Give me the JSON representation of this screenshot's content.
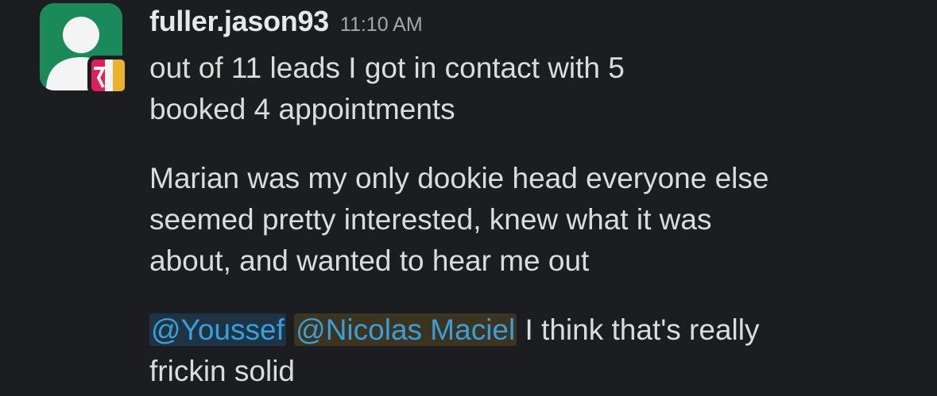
{
  "message": {
    "author": "fuller.jason93",
    "timestamp": "11:10 AM",
    "paragraphs": {
      "p1": {
        "line1": "out of 11 leads I got in contact with 5",
        "line2": "booked 4 appointments"
      },
      "p2": {
        "line1": "Marian was my only dookie head everyone else",
        "line2": "seemed pretty interested, knew what it was",
        "line3": "about, and wanted to hear me out"
      },
      "p3": {
        "mention1": "@Youssef",
        "mention2": "@Nicolas Maciel",
        "line1_rest": " I think that's really",
        "line2": "frickin solid"
      }
    }
  },
  "icons": {
    "avatar": "user-avatar-icon",
    "badge": "app-badge-icon"
  },
  "colors": {
    "background": "#1b1d21",
    "avatar_bg": "#1b8a5a",
    "mention_text": "#3a9fd9",
    "mention_bg_1": "#1e3445",
    "mention_bg_2": "#3a3420",
    "badge_red": "#e01e5a",
    "badge_yellow": "#ecb22e"
  }
}
